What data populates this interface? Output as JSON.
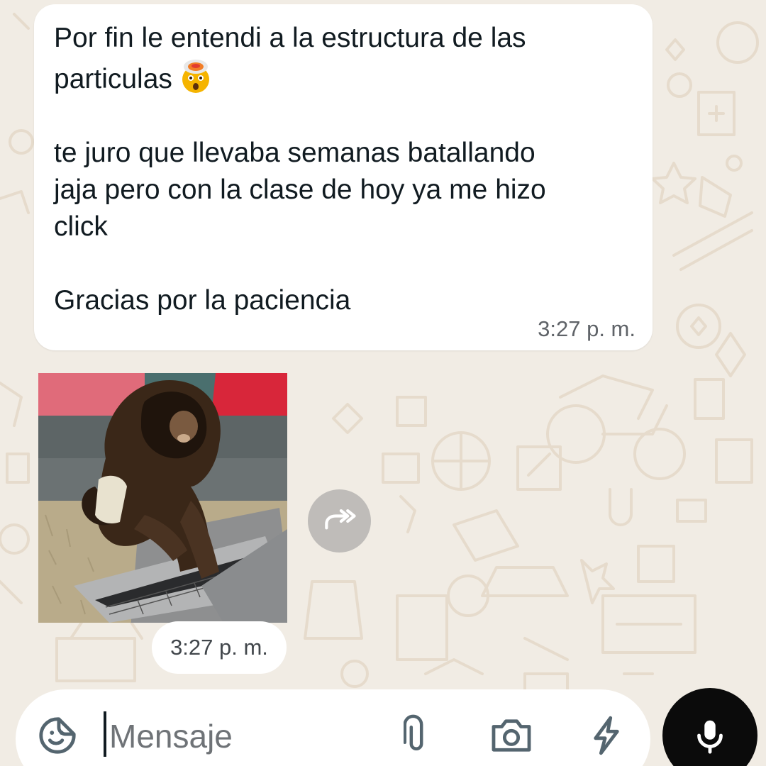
{
  "conversation": {
    "message": {
      "text": "Por fin le entendi a la estructura de las\nparticulas",
      "text_continued": "\n\nte juro que llevaba semanas batallando\njaja pero con la clase de hoy ya me hizo\nclick\n\nGracias por la paciencia",
      "emoji": "exploding-head",
      "time": "3:27 p. m."
    },
    "media": {
      "kind": "gif",
      "subject": "monkey-typing-on-laptop",
      "time": "3:27 p. m."
    }
  },
  "composer": {
    "placeholder": "Mensaje",
    "icons": [
      "sticker-icon",
      "attach-icon",
      "camera-icon",
      "bolt-icon",
      "microphone-icon"
    ]
  },
  "colors": {
    "wallpaper": "#f1ece4",
    "doodle": "#e5d9c9",
    "bubble": "#ffffff",
    "text": "#111b21",
    "meta_text": "#5f6368",
    "icon": "#54656f",
    "mic_button": "#0b0b0b"
  }
}
